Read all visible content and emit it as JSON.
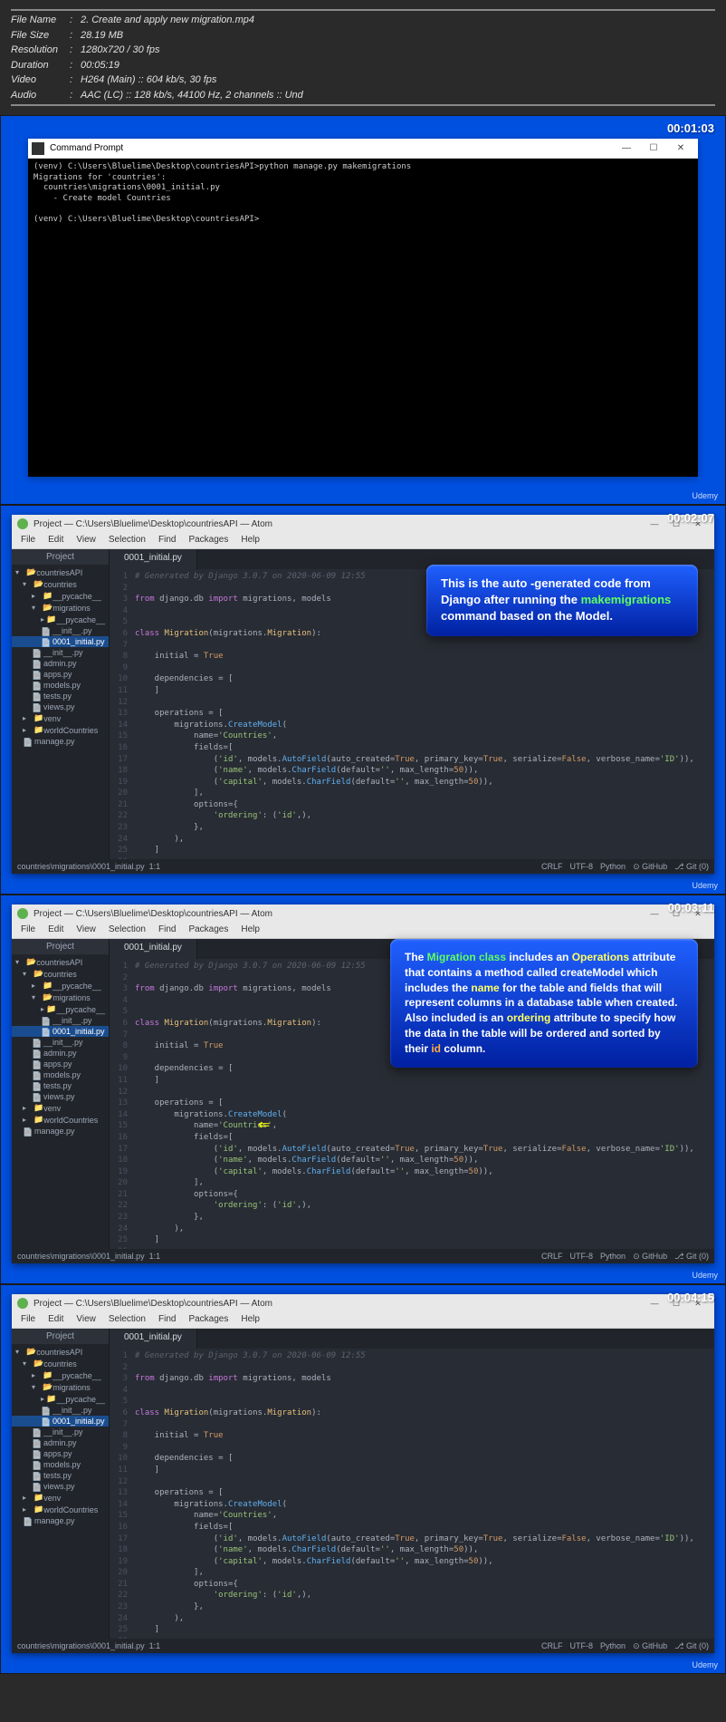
{
  "meta": {
    "fileName": {
      "label": "File Name",
      "value": "2. Create and apply new migration.mp4"
    },
    "fileSize": {
      "label": "File Size",
      "value": "28.19 MB"
    },
    "resolution": {
      "label": "Resolution",
      "value": "1280x720 / 30 fps"
    },
    "duration": {
      "label": "Duration",
      "value": "00:05:19"
    },
    "video": {
      "label": "Video",
      "value": "H264 (Main) :: 604 kb/s, 30 fps"
    },
    "audio": {
      "label": "Audio",
      "value": "AAC (LC) :: 128 kb/s, 44100 Hz, 2 channels :: Und"
    }
  },
  "shots": [
    {
      "timestamp": "00:01:03"
    },
    {
      "timestamp": "00:02:07"
    },
    {
      "timestamp": "00:03:11"
    },
    {
      "timestamp": "00:04:15"
    }
  ],
  "cmd": {
    "title": "Command Prompt",
    "lines": "(venv) C:\\Users\\Bluelime\\Desktop\\countriesAPI>python manage.py makemigrations\nMigrations for 'countries':\n  countries\\migrations\\0001_initial.py\n    - Create model Countries\n\n(venv) C:\\Users\\Bluelime\\Desktop\\countriesAPI>"
  },
  "atom": {
    "title": "Project — C:\\Users\\Bluelime\\Desktop\\countriesAPI — Atom",
    "menus": [
      "File",
      "Edit",
      "View",
      "Selection",
      "Find",
      "Packages",
      "Help"
    ],
    "projectLabel": "Project",
    "tabName": "0001_initial.py",
    "tree": [
      {
        "name": "countriesAPI",
        "type": "folder-open",
        "indent": 0
      },
      {
        "name": "countries",
        "type": "folder-open",
        "indent": 1
      },
      {
        "name": "__pycache__",
        "type": "folder",
        "indent": 2
      },
      {
        "name": "migrations",
        "type": "folder-open",
        "indent": 2
      },
      {
        "name": "__pycache__",
        "type": "folder",
        "indent": 3
      },
      {
        "name": "__init__.py",
        "type": "file",
        "indent": 3
      },
      {
        "name": "0001_initial.py",
        "type": "file",
        "indent": 3,
        "selected": true
      },
      {
        "name": "__init__.py",
        "type": "file",
        "indent": 2
      },
      {
        "name": "admin.py",
        "type": "file",
        "indent": 2
      },
      {
        "name": "apps.py",
        "type": "file",
        "indent": 2
      },
      {
        "name": "models.py",
        "type": "file",
        "indent": 2
      },
      {
        "name": "tests.py",
        "type": "file",
        "indent": 2
      },
      {
        "name": "views.py",
        "type": "file",
        "indent": 2
      },
      {
        "name": "venv",
        "type": "folder",
        "indent": 1
      },
      {
        "name": "worldCountries",
        "type": "folder",
        "indent": 1
      },
      {
        "name": "manage.py",
        "type": "file",
        "indent": 1
      }
    ],
    "statusPath": "countries\\migrations\\0001_initial.py",
    "statusPos": "1:1",
    "statusRight": [
      "CRLF",
      "UTF-8",
      "Python",
      "⊙ GitHub",
      "⎇ Git (0)"
    ],
    "code": {
      "comment": "# Generated by Django 3.0.7 on 2020-06-09 12:55",
      "line3": {
        "from": "from",
        "mod": " django.db ",
        "import": "import",
        "rest": " migrations, models"
      },
      "line6": {
        "class": "class ",
        "name": "Migration",
        "paren": "(migrations.",
        "base": "Migration",
        "end": "):"
      },
      "line8": "    initial = True",
      "line10": "    dependencies = [",
      "line11": "    ]",
      "line13": "    operations = [",
      "line14": {
        "indent": "        migrations.",
        "func": "CreateModel",
        "end": "("
      },
      "line15": {
        "indent": "            name=",
        "str": "'Countries'",
        "end": ","
      },
      "line16": "            fields=[",
      "line17a": "                (",
      "line17b": "'id'",
      "line17c": ", models.",
      "line17d": "AutoField",
      "line17e": "(auto_created=",
      "line17f": "True",
      "line17g": ", primary_key=",
      "line17h": "True",
      "line17i": ", serialize=",
      "line17j": "False",
      "line17k": ", verbose_name=",
      "line17l": "'ID'",
      "line17m": ")),",
      "line18a": "                (",
      "line18b": "'name'",
      "line18c": ", models.",
      "line18d": "CharField",
      "line18e": "(default=",
      "line18f": "''",
      "line18g": ", max_length=",
      "line18h": "50",
      "line18i": ")),",
      "line19a": "                (",
      "line19b": "'capital'",
      "line19c": ", models.",
      "line19d": "CharField",
      "line19e": "(default=",
      "line19f": "''",
      "line19g": ", max_length=",
      "line19h": "50",
      "line19i": ")),",
      "line20": "            ],",
      "line21": "            options={",
      "line22a": "                ",
      "line22b": "'ordering'",
      "line22c": ": (",
      "line22d": "'id'",
      "line22e": ",),",
      "line23": "            },",
      "line24": "        ),",
      "line25": "    ]"
    }
  },
  "callout1": {
    "p1": "This is the auto -generated code from Django after running the ",
    "highlight": "makemigrations",
    "p2": " command based on the Model."
  },
  "callout2": {
    "t1": "The ",
    "h1": "Migration class",
    "t2": " includes an ",
    "h2": "Operations",
    "t3": " attribute that contains a method called createModel which includes the ",
    "h3": "name",
    "t4": " for the table and fields that will represent columns in a database table when created. Also included  is an ",
    "h4": "ordering",
    "t5": " attribute to specify how the data in the table will be ordered and sorted by their ",
    "h5": "id",
    "t6": " column."
  },
  "udemy": "Udemy"
}
